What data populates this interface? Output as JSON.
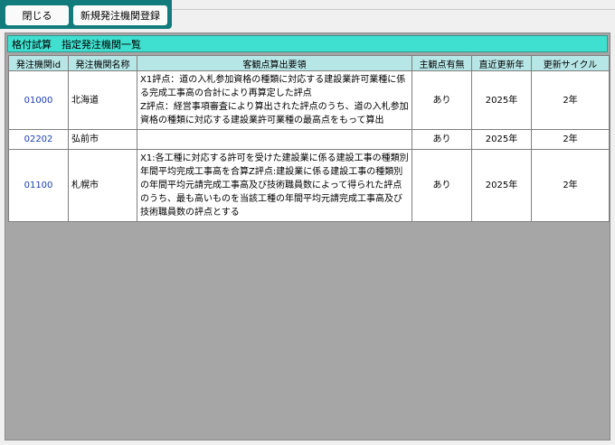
{
  "toolbar": {
    "close_label": "閉じる",
    "new_label": "新規発注機関登録"
  },
  "panel": {
    "title": "格付試算　指定発注機関一覧"
  },
  "table": {
    "headers": {
      "id": "発注機関id",
      "name": "発注機関名称",
      "rule": "客観点算出要領",
      "has_score": "主観点有無",
      "updated": "直近更新年",
      "cycle": "更新サイクル"
    },
    "rows": [
      {
        "id": "01000",
        "name": "北海道",
        "rule": "X1評点：道の入札参加資格の種類に対応する建設業許可業種に係る完成工事高の合計により再算定した評点\nZ評点：経営事項審査により算出された評点のうち、道の入札参加資格の種類に対応する建設業許可業種の最高点をもって算出",
        "has_score": "あり",
        "updated": "2025年",
        "cycle": "2年"
      },
      {
        "id": "02202",
        "name": "弘前市",
        "rule": "",
        "has_score": "あり",
        "updated": "2025年",
        "cycle": "2年"
      },
      {
        "id": "01100",
        "name": "札幌市",
        "rule": "X1:各工種に対応する許可を受けた建設業に係る建設工事の種類別年間平均完成工事高を合算Z評点:建設業に係る建設工事の種類別の年間平均元請完成工事高及び技術職員数によって得られた評点のうち、最も高いものを当該工種の年間平均元請完成工事高及び技術職員数の評点とする",
        "has_score": "あり",
        "updated": "2025年",
        "cycle": "2年"
      }
    ]
  }
}
